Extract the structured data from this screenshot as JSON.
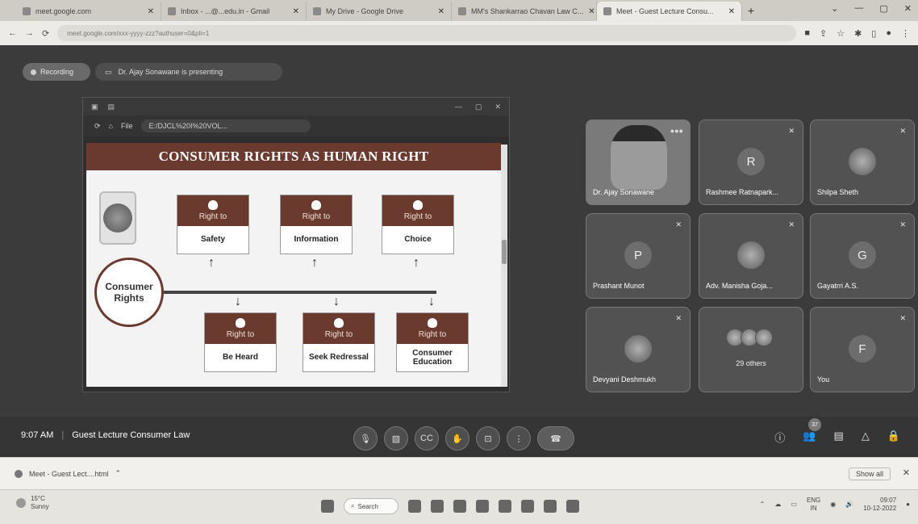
{
  "browser": {
    "tabs": [
      {
        "label": "meet.google.com",
        "active": false
      },
      {
        "label": "Inbox - ...@...edu.in - Gmail",
        "active": false
      },
      {
        "label": "My Drive - Google Drive",
        "active": false
      },
      {
        "label": "MM's Shankarrao Chavan Law C...",
        "active": false
      },
      {
        "label": "Meet - Guest Lecture Consu...",
        "active": true
      }
    ],
    "new_tab": "+",
    "window_controls": [
      "⌄",
      "—",
      "▢",
      "✕"
    ],
    "address": "meet.google.com/xxx-yyyy-zzz?authuser=0&pli=1",
    "nav": [
      "←",
      "→",
      "⟳"
    ]
  },
  "meet": {
    "recording_label": "Recording",
    "presenting_label": "Dr. Ajay Sonawane is presenting",
    "time": "9:07 AM",
    "meeting_title": "Guest Lecture Consumer Law",
    "participant_count": "37"
  },
  "shared_screen": {
    "file_label": "File",
    "url": "E:/DJCL%20I%20VOL...",
    "slide_title": "CONSUMER RIGHTS AS HUMAN RIGHT",
    "center_label": "Consumer Rights",
    "top_cards": [
      {
        "head": "Right to",
        "body": "Safety"
      },
      {
        "head": "Right to",
        "body": "Information"
      },
      {
        "head": "Right to",
        "body": "Choice"
      }
    ],
    "bottom_cards": [
      {
        "head": "Right to",
        "body": "Be Heard"
      },
      {
        "head": "Right to",
        "body": "Seek Redressal"
      },
      {
        "head": "Right to",
        "body": "Consumer Education"
      }
    ]
  },
  "participants": [
    {
      "name": "Dr. Ajay Sonawane",
      "initial": "",
      "type": "video"
    },
    {
      "name": "Rashmee Ratnapark...",
      "initial": "R",
      "type": "initial"
    },
    {
      "name": "Shilpa Sheth",
      "initial": "",
      "type": "photo"
    },
    {
      "name": "Prashant Munot",
      "initial": "P",
      "type": "initial"
    },
    {
      "name": "Adv. Manisha Goja...",
      "initial": "",
      "type": "photo"
    },
    {
      "name": "Gayatrri A.S.",
      "initial": "G",
      "type": "initial"
    },
    {
      "name": "Devyani Deshmukh",
      "initial": "",
      "type": "photo"
    },
    {
      "name": "29 others",
      "initial": "",
      "type": "group"
    },
    {
      "name": "You",
      "initial": "F",
      "type": "initial"
    }
  ],
  "downloads": {
    "file": "Meet - Guest Lect....html",
    "show_all": "Show all"
  },
  "taskbar": {
    "temp": "15°C",
    "weather": "Sunny",
    "search": "Search",
    "lang": "ENG",
    "region": "IN",
    "time": "09:07",
    "date": "10-12-2022"
  }
}
